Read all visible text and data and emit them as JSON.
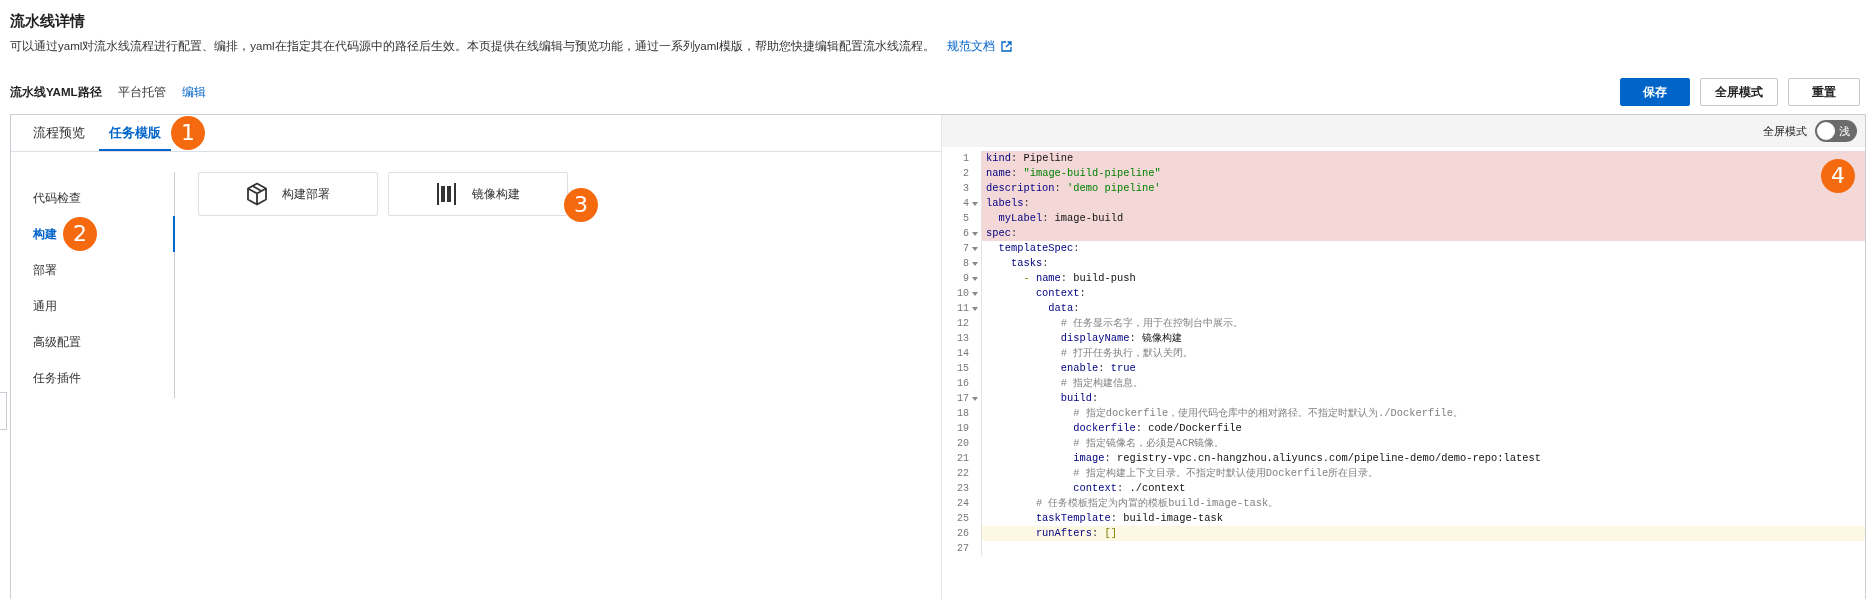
{
  "page": {
    "title": "流水线详情",
    "description": "可以通过yaml对流水线流程进行配置、编排，yaml在指定其在代码源中的路径后生效。本页提供在线编辑与预览功能，通过一系列yaml模版，帮助您快捷编辑配置流水线流程。",
    "doc_link": "规范文档"
  },
  "path_row": {
    "label": "流水线YAML路径",
    "value": "平台托管",
    "edit_link": "编辑"
  },
  "actions": [
    {
      "label": "保存",
      "kind": "primary"
    },
    {
      "label": "全屏模式",
      "kind": "default"
    },
    {
      "label": "重置",
      "kind": "default"
    }
  ],
  "tabs": [
    {
      "label": "流程预览",
      "selected": false
    },
    {
      "label": "任务模版",
      "selected": true,
      "callout": "1"
    }
  ],
  "sidebar": {
    "items": [
      {
        "label": "代码检查",
        "selected": false
      },
      {
        "label": "构建",
        "selected": true,
        "callout": "2"
      },
      {
        "label": "部署",
        "selected": false
      },
      {
        "label": "通用",
        "selected": false
      },
      {
        "label": "高级配置",
        "selected": false
      },
      {
        "label": "任务插件",
        "selected": false
      }
    ]
  },
  "templates": [
    {
      "label": "构建部署"
    },
    {
      "label": "镜像构建",
      "callout": "3"
    }
  ],
  "editor": {
    "toggle": {
      "label": "全屏模式",
      "on": false,
      "text": "浅"
    },
    "callout": "4",
    "lines": [
      {
        "number": "1",
        "fold": false,
        "error": true,
        "current": false,
        "parts": [
          {
            "kind": "key",
            "text": "kind"
          },
          {
            "kind": "punct",
            "text": ": "
          },
          {
            "kind": "plain",
            "text": "Pipeline"
          }
        ]
      },
      {
        "number": "2",
        "fold": false,
        "error": true,
        "current": false,
        "parts": [
          {
            "kind": "key",
            "text": "name"
          },
          {
            "kind": "punct",
            "text": ": "
          },
          {
            "kind": "string",
            "text": "\"image-build-pipeline\""
          }
        ]
      },
      {
        "number": "3",
        "fold": false,
        "error": true,
        "current": false,
        "parts": [
          {
            "kind": "key",
            "text": "description"
          },
          {
            "kind": "punct",
            "text": ": "
          },
          {
            "kind": "string",
            "text": "'demo pipeline'"
          }
        ]
      },
      {
        "number": "4",
        "fold": true,
        "error": true,
        "current": false,
        "parts": [
          {
            "kind": "key",
            "text": "labels"
          },
          {
            "kind": "punct",
            "text": ":"
          }
        ]
      },
      {
        "number": "5",
        "fold": false,
        "error": true,
        "current": false,
        "parts": [
          {
            "kind": "key",
            "text": "  myLabel"
          },
          {
            "kind": "punct",
            "text": ": "
          },
          {
            "kind": "plain",
            "text": "image-build"
          }
        ]
      },
      {
        "number": "6",
        "fold": true,
        "error": true,
        "current": false,
        "parts": [
          {
            "kind": "key",
            "text": "spec"
          },
          {
            "kind": "punct",
            "text": ":"
          }
        ]
      },
      {
        "number": "7",
        "fold": true,
        "error": false,
        "current": false,
        "parts": [
          {
            "kind": "key",
            "text": "  templateSpec"
          },
          {
            "kind": "punct",
            "text": ":"
          }
        ]
      },
      {
        "number": "8",
        "fold": true,
        "error": false,
        "current": false,
        "parts": [
          {
            "kind": "key",
            "text": "    tasks"
          },
          {
            "kind": "punct",
            "text": ":"
          }
        ]
      },
      {
        "number": "9",
        "fold": true,
        "error": false,
        "current": false,
        "parts": [
          {
            "kind": "dash",
            "text": "      - "
          },
          {
            "kind": "key",
            "text": "name"
          },
          {
            "kind": "punct",
            "text": ": "
          },
          {
            "kind": "plain",
            "text": "build-push"
          }
        ]
      },
      {
        "number": "10",
        "fold": true,
        "error": false,
        "current": false,
        "parts": [
          {
            "kind": "key",
            "text": "        context"
          },
          {
            "kind": "punct",
            "text": ":"
          }
        ]
      },
      {
        "number": "11",
        "fold": true,
        "error": false,
        "current": false,
        "parts": [
          {
            "kind": "key",
            "text": "          data"
          },
          {
            "kind": "punct",
            "text": ":"
          }
        ]
      },
      {
        "number": "12",
        "fold": false,
        "error": false,
        "current": false,
        "parts": [
          {
            "kind": "comment",
            "text": "            # 任务显示名字，用于在控制台中展示。"
          }
        ]
      },
      {
        "number": "13",
        "fold": false,
        "error": false,
        "current": false,
        "parts": [
          {
            "kind": "key",
            "text": "            displayName"
          },
          {
            "kind": "punct",
            "text": ": "
          },
          {
            "kind": "plain",
            "text": "镜像构建"
          }
        ]
      },
      {
        "number": "14",
        "fold": false,
        "error": false,
        "current": false,
        "parts": [
          {
            "kind": "comment",
            "text": "            # 打开任务执行，默认关闭。"
          }
        ]
      },
      {
        "number": "15",
        "fold": false,
        "error": false,
        "current": false,
        "parts": [
          {
            "kind": "key",
            "text": "            enable"
          },
          {
            "kind": "punct",
            "text": ": "
          },
          {
            "kind": "keyword",
            "text": "true"
          }
        ]
      },
      {
        "number": "16",
        "fold": false,
        "error": false,
        "current": false,
        "parts": [
          {
            "kind": "comment",
            "text": "            # 指定构建信息。"
          }
        ]
      },
      {
        "number": "17",
        "fold": true,
        "error": false,
        "current": false,
        "parts": [
          {
            "kind": "key",
            "text": "            build"
          },
          {
            "kind": "punct",
            "text": ":"
          }
        ]
      },
      {
        "number": "18",
        "fold": false,
        "error": false,
        "current": false,
        "parts": [
          {
            "kind": "comment",
            "text": "              # 指定dockerfile，使用代码仓库中的相对路径。不指定时默认为./Dockerfile。"
          }
        ]
      },
      {
        "number": "19",
        "fold": false,
        "error": false,
        "current": false,
        "parts": [
          {
            "kind": "key",
            "text": "              dockerfile"
          },
          {
            "kind": "punct",
            "text": ": "
          },
          {
            "kind": "plain",
            "text": "code/Dockerfile"
          }
        ]
      },
      {
        "number": "20",
        "fold": false,
        "error": false,
        "current": false,
        "parts": [
          {
            "kind": "comment",
            "text": "              # 指定镜像名，必须是ACR镜像。"
          }
        ]
      },
      {
        "number": "21",
        "fold": false,
        "error": false,
        "current": false,
        "parts": [
          {
            "kind": "key",
            "text": "              image"
          },
          {
            "kind": "punct",
            "text": ": "
          },
          {
            "kind": "plain",
            "text": "registry-vpc.cn-hangzhou.aliyuncs.com/pipeline-demo/demo-repo:latest"
          }
        ]
      },
      {
        "number": "22",
        "fold": false,
        "error": false,
        "current": false,
        "parts": [
          {
            "kind": "comment",
            "text": "              # 指定构建上下文目录。不指定时默认使用Dockerfile所在目录。"
          }
        ]
      },
      {
        "number": "23",
        "fold": false,
        "error": false,
        "current": false,
        "parts": [
          {
            "kind": "key",
            "text": "              context"
          },
          {
            "kind": "punct",
            "text": ": "
          },
          {
            "kind": "plain",
            "text": "./context"
          }
        ]
      },
      {
        "number": "24",
        "fold": false,
        "error": false,
        "current": false,
        "parts": [
          {
            "kind": "comment",
            "text": "        # 任务模板指定为内置的模板build-image-task。"
          }
        ]
      },
      {
        "number": "25",
        "fold": false,
        "error": false,
        "current": false,
        "parts": [
          {
            "kind": "key",
            "text": "        taskTemplate"
          },
          {
            "kind": "punct",
            "text": ": "
          },
          {
            "kind": "plain",
            "text": "build-image-task"
          }
        ]
      },
      {
        "number": "26",
        "fold": false,
        "error": false,
        "current": true,
        "parts": [
          {
            "kind": "key",
            "text": "        runAfters"
          },
          {
            "kind": "punct",
            "text": ": "
          },
          {
            "kind": "dash",
            "text": "[]"
          }
        ]
      },
      {
        "number": "27",
        "fold": false
      }
    ]
  }
}
